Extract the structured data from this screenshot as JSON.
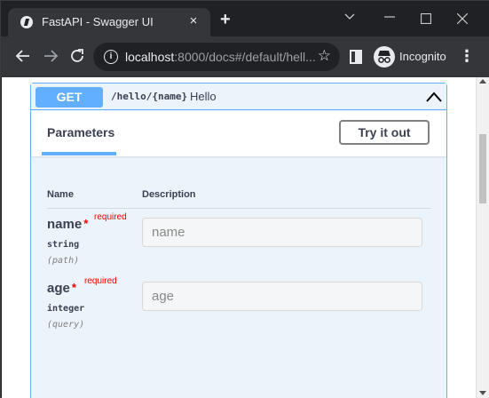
{
  "browser": {
    "tab_title": "FastAPI - Swagger UI",
    "tab_close": "×",
    "new_tab": "+",
    "url_host": "localhost",
    "url_rest": ":8000/docs#/default/hell...",
    "info_glyph": "i",
    "star_glyph": "☆",
    "incognito_label": "Incognito",
    "menu_glyph": "⋮"
  },
  "operation": {
    "method": "GET",
    "path": "/hello/{name}",
    "summary": "Hello",
    "accent_color": "#61affe"
  },
  "parameters_section": {
    "title": "Parameters",
    "try_button": "Try it out",
    "columns": {
      "name": "Name",
      "description": "Description"
    },
    "params": [
      {
        "name": "name",
        "required_star": "*",
        "required_label": "required",
        "type": "string",
        "in": "(path)",
        "placeholder": "name"
      },
      {
        "name": "age",
        "required_star": "*",
        "required_label": "required",
        "type": "integer",
        "in": "(query)",
        "placeholder": "age"
      }
    ]
  }
}
